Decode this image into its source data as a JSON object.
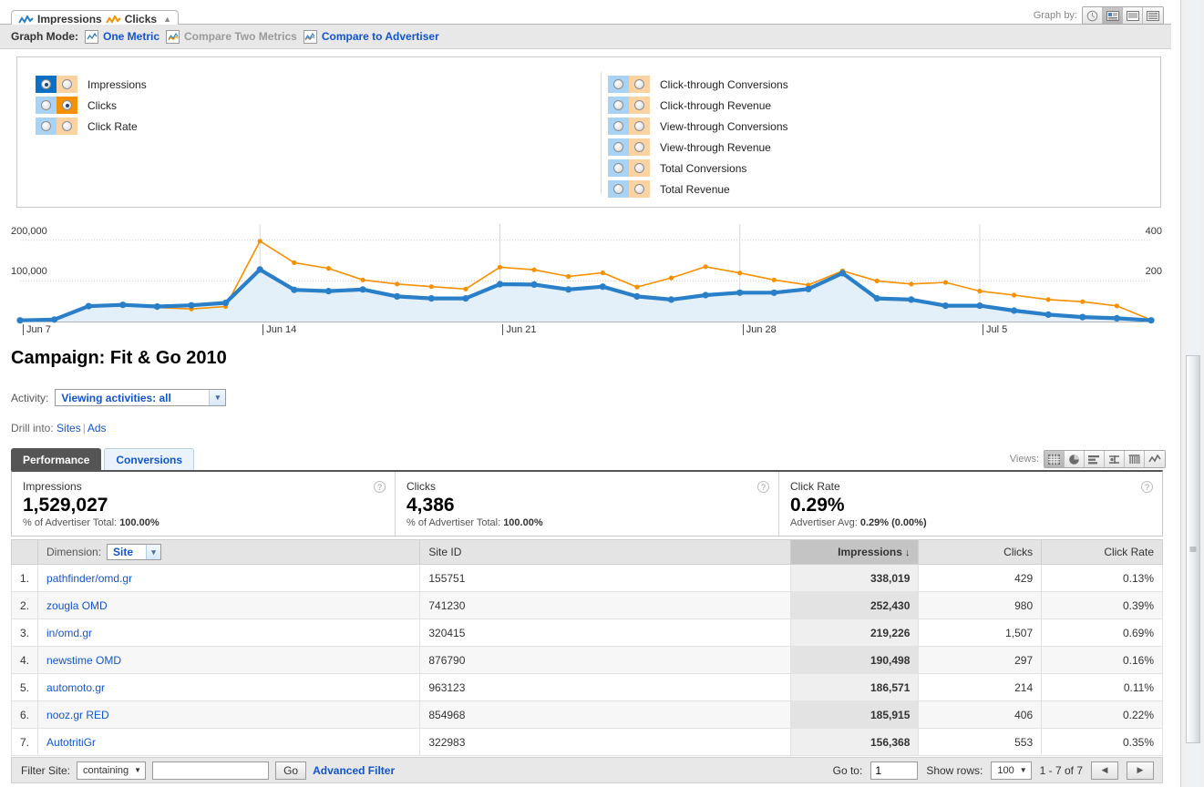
{
  "graph_panel": {
    "tab": {
      "impressions_label": "Impressions",
      "clicks_label": "Clicks",
      "collapse_icon": "▲"
    },
    "graph_by": {
      "label": "Graph by:",
      "options": [
        "clock-icon",
        "day-icon",
        "week-icon",
        "month-icon"
      ],
      "selected_index": 1
    },
    "graph_mode": {
      "label": "Graph Mode:",
      "options": [
        {
          "label": "One Metric",
          "state": "active"
        },
        {
          "label": "Compare Two Metrics",
          "state": "disabled"
        },
        {
          "label": "Compare to Advertiser",
          "state": "link"
        }
      ]
    },
    "metrics_left": [
      {
        "label": "Impressions",
        "blue": true,
        "orange": false
      },
      {
        "label": "Clicks",
        "blue": false,
        "orange": true
      },
      {
        "label": "Click Rate",
        "blue": false,
        "orange": false
      }
    ],
    "metrics_right": [
      {
        "label": "Click-through Conversions",
        "blue": false,
        "orange": false
      },
      {
        "label": "Click-through Revenue",
        "blue": false,
        "orange": false
      },
      {
        "label": "View-through Conversions",
        "blue": false,
        "orange": false
      },
      {
        "label": "View-through Revenue",
        "blue": false,
        "orange": false
      },
      {
        "label": "Total Conversions",
        "blue": false,
        "orange": false
      },
      {
        "label": "Total Revenue",
        "blue": false,
        "orange": false
      }
    ],
    "colors": {
      "blue": "#2a7fc9",
      "orange": "#f59000",
      "area": "#e3f0fa"
    }
  },
  "chart_data": {
    "type": "line",
    "title": "",
    "xlabel": "",
    "ylabel": "",
    "grid": true,
    "legend_position": "tabs-top",
    "x_tick_labels": [
      "Jun 7",
      "Jun 14",
      "Jun 21",
      "Jun 28",
      "Jul 5"
    ],
    "x_tick_indices": [
      0,
      7,
      14,
      21,
      28
    ],
    "x": [
      0,
      1,
      2,
      3,
      4,
      5,
      6,
      7,
      8,
      9,
      10,
      11,
      12,
      13,
      14,
      15,
      16,
      17,
      18,
      19,
      20,
      21,
      22,
      23,
      24,
      25,
      26,
      27,
      28,
      29,
      30,
      31,
      32,
      33
    ],
    "y_left": {
      "label_values": [
        100000,
        200000
      ],
      "ylim": [
        0,
        240000
      ],
      "axis_color": "#2a7fc9"
    },
    "y_right": {
      "label_values": [
        200,
        400
      ],
      "ylim": [
        0,
        480
      ],
      "axis_color": "#f59000"
    },
    "series": [
      {
        "name": "Impressions",
        "color": "#2a7fc9",
        "axis": "left",
        "filled": true,
        "values": [
          3000,
          5000,
          38000,
          41000,
          37000,
          40000,
          46000,
          128000,
          78000,
          75000,
          79000,
          62000,
          57000,
          57000,
          92000,
          91000,
          79000,
          86000,
          62000,
          54000,
          65000,
          71000,
          71000,
          80000,
          119000,
          57000,
          54000,
          39000,
          39000,
          27000,
          17000,
          11000,
          8000,
          3000
        ]
      },
      {
        "name": "Clicks",
        "color": "#f59000",
        "axis": "right",
        "filled": false,
        "values": [
          6,
          9,
          74,
          80,
          69,
          62,
          74,
          396,
          290,
          262,
          205,
          185,
          172,
          160,
          268,
          255,
          222,
          240,
          170,
          215,
          270,
          239,
          205,
          180,
          250,
          200,
          185,
          193,
          150,
          130,
          108,
          98,
          77,
          8
        ]
      }
    ]
  },
  "page": {
    "title": "Campaign: Fit & Go 2010",
    "activity": {
      "label": "Activity:",
      "value": "Viewing activities: all"
    },
    "drill": {
      "label": "Drill into:",
      "links": [
        "Sites",
        "Ads"
      ],
      "separator": "|"
    },
    "views": {
      "label": "Views:",
      "icons": [
        "table-view-icon",
        "pie-view-icon",
        "bar-view-icon",
        "scatter-view-icon",
        "column-view-icon",
        "line-view-icon"
      ],
      "selected_index": 0
    },
    "tabs": [
      {
        "label": "Performance",
        "active": true
      },
      {
        "label": "Conversions",
        "active": false
      }
    ],
    "summary": [
      {
        "name": "Impressions",
        "value": "1,529,027",
        "sub_prefix": "% of Advertiser Total: ",
        "sub_value": "100.00%",
        "help": "?"
      },
      {
        "name": "Clicks",
        "value": "4,386",
        "sub_prefix": "% of Advertiser Total: ",
        "sub_value": "100.00%",
        "help": "?"
      },
      {
        "name": "Click Rate",
        "value": "0.29%",
        "sub_prefix": "Advertiser Avg: ",
        "sub_value": "0.29% (0.00%)",
        "help": "?"
      }
    ]
  },
  "table": {
    "dimension": {
      "label": "Dimension:",
      "value": "Site"
    },
    "headers": {
      "site_id": "Site ID",
      "impressions": "Impressions",
      "clicks": "Clicks",
      "click_rate": "Click Rate",
      "sort_arrow": "↓",
      "sorted_column": "impressions"
    },
    "rows": [
      {
        "idx": "1.",
        "site": "pathfinder/omd.gr",
        "site_id": "155751",
        "impressions": "338,019",
        "clicks": "429",
        "click_rate": "0.13%"
      },
      {
        "idx": "2.",
        "site": "zougla OMD",
        "site_id": "741230",
        "impressions": "252,430",
        "clicks": "980",
        "click_rate": "0.39%"
      },
      {
        "idx": "3.",
        "site": "in/omd.gr",
        "site_id": "320415",
        "impressions": "219,226",
        "clicks": "1,507",
        "click_rate": "0.69%"
      },
      {
        "idx": "4.",
        "site": "newstime OMD",
        "site_id": "876790",
        "impressions": "190,498",
        "clicks": "297",
        "click_rate": "0.16%"
      },
      {
        "idx": "5.",
        "site": "automoto.gr",
        "site_id": "963123",
        "impressions": "186,571",
        "clicks": "214",
        "click_rate": "0.11%"
      },
      {
        "idx": "6.",
        "site": "nooz.gr RED",
        "site_id": "854968",
        "impressions": "185,915",
        "clicks": "406",
        "click_rate": "0.22%"
      },
      {
        "idx": "7.",
        "site": "AutotritiGr",
        "site_id": "322983",
        "impressions": "156,368",
        "clicks": "553",
        "click_rate": "0.35%"
      }
    ]
  },
  "footer": {
    "filter_label": "Filter Site:",
    "filter_operator": "containing",
    "filter_value": "",
    "go_label": "Go",
    "advanced_filter": "Advanced Filter",
    "goto_label": "Go to:",
    "goto_value": "1",
    "show_rows_label": "Show rows:",
    "show_rows_value": "100",
    "range": "1 - 7 of 7",
    "prev_icon": "◀",
    "next_icon": "▶"
  }
}
